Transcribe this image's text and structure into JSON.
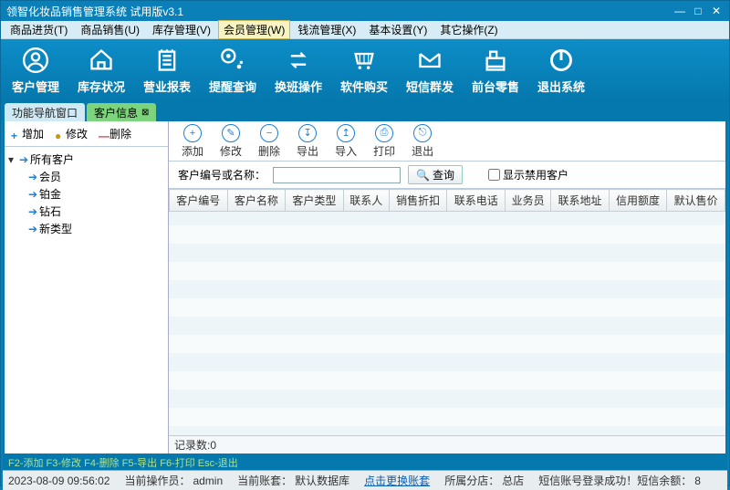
{
  "window": {
    "title": "领智化妆品销售管理系统 试用版v3.1"
  },
  "menubar": [
    {
      "label": "商品进货(T)"
    },
    {
      "label": "商品销售(U)"
    },
    {
      "label": "库存管理(V)"
    },
    {
      "label": "会员管理(W)",
      "active": true
    },
    {
      "label": "钱流管理(X)"
    },
    {
      "label": "基本设置(Y)"
    },
    {
      "label": "其它操作(Z)"
    }
  ],
  "bigToolbar": [
    {
      "name": "customer-manage",
      "label": "客户管理",
      "icon": "user"
    },
    {
      "name": "inventory-status",
      "label": "库存状况",
      "icon": "home"
    },
    {
      "name": "business-report",
      "label": "营业报表",
      "icon": "notepad"
    },
    {
      "name": "reminder-query",
      "label": "提醒查询",
      "icon": "alert"
    },
    {
      "name": "shift-change",
      "label": "换班操作",
      "icon": "swap"
    },
    {
      "name": "software-buy",
      "label": "软件购买",
      "icon": "cart"
    },
    {
      "name": "sms-send",
      "label": "短信群发",
      "icon": "mail"
    },
    {
      "name": "front-retail",
      "label": "前台零售",
      "icon": "register"
    },
    {
      "name": "exit-system",
      "label": "退出系统",
      "icon": "power"
    }
  ],
  "tabs": [
    {
      "name": "nav-window",
      "label": "功能导航窗口",
      "active": false,
      "closable": false
    },
    {
      "name": "customer-info",
      "label": "客户信息",
      "active": true,
      "closable": true
    }
  ],
  "sideToolbar": {
    "add": "增加",
    "edit": "修改",
    "del": "删除"
  },
  "tree": {
    "root": {
      "label": "所有客户"
    },
    "children": [
      {
        "label": "会员"
      },
      {
        "label": "铂金"
      },
      {
        "label": "钻石"
      },
      {
        "label": "新类型"
      }
    ]
  },
  "mainToolbar": [
    {
      "name": "add",
      "label": "添加",
      "glyph": "+"
    },
    {
      "name": "edit",
      "label": "修改",
      "glyph": "✎"
    },
    {
      "name": "delete",
      "label": "删除",
      "glyph": "−"
    },
    {
      "name": "export",
      "label": "导出",
      "glyph": "↧"
    },
    {
      "name": "import",
      "label": "导入",
      "glyph": "↥"
    },
    {
      "name": "print",
      "label": "打印",
      "glyph": "⎙"
    },
    {
      "name": "exit",
      "label": "退出",
      "glyph": "⎋"
    }
  ],
  "search": {
    "label": "客户编号或名称：",
    "value": "",
    "button": "查询",
    "showDisabledLabel": "显示禁用客户"
  },
  "columns": [
    "客户编号",
    "客户名称",
    "客户类型",
    "联系人",
    "销售折扣",
    "联系电话",
    "业务员",
    "联系地址",
    "信用额度",
    "默认售价"
  ],
  "records": {
    "label": "记录数:",
    "count": "0"
  },
  "hintbar": "F2-添加 F3-修改 F4-删除 F5-导出 F6-打印 Esc-退出",
  "statusbar": {
    "datetime": "2023-08-09 09:56:02",
    "operatorLabel": "当前操作员：",
    "operator": "admin",
    "accountLabel": "当前账套：",
    "account": "默认数据库",
    "switchLink": "点击更换账套",
    "branchLabel": "所属分店：",
    "branch": "总店",
    "smsLabel": "短信账号登录成功！短信余额：",
    "smsBalance": "8"
  }
}
